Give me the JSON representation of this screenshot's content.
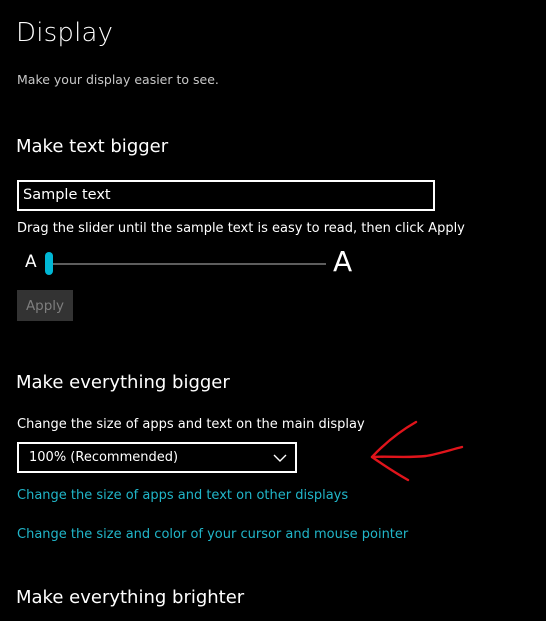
{
  "page": {
    "title": "Display",
    "subtitle": "Make your display easier to see."
  },
  "make_text_bigger": {
    "heading": "Make text bigger",
    "sample_text": "Sample text",
    "hint": "Drag the slider until the sample text is easy to read, then click Apply",
    "slider_small_label": "A",
    "slider_large_label": "A",
    "slider_level": 0,
    "apply_label": "Apply",
    "apply_enabled": false
  },
  "make_everything_bigger": {
    "heading": "Make everything bigger",
    "label": "Change the size of apps and text on the main display",
    "dropdown_value": "100% (Recommended)",
    "links": [
      "Change the size of apps and text on other displays",
      "Change the size and color of your cursor and mouse pointer"
    ]
  },
  "make_everything_brighter": {
    "heading": "Make everything brighter"
  },
  "colors": {
    "background": "#000000",
    "accent": "#00b7d5",
    "link": "#21b6c9",
    "annotation": "#e0141b"
  },
  "icons": {
    "dropdown": "chevron-down-icon",
    "annotation": "hand-drawn-arrow-icon"
  }
}
